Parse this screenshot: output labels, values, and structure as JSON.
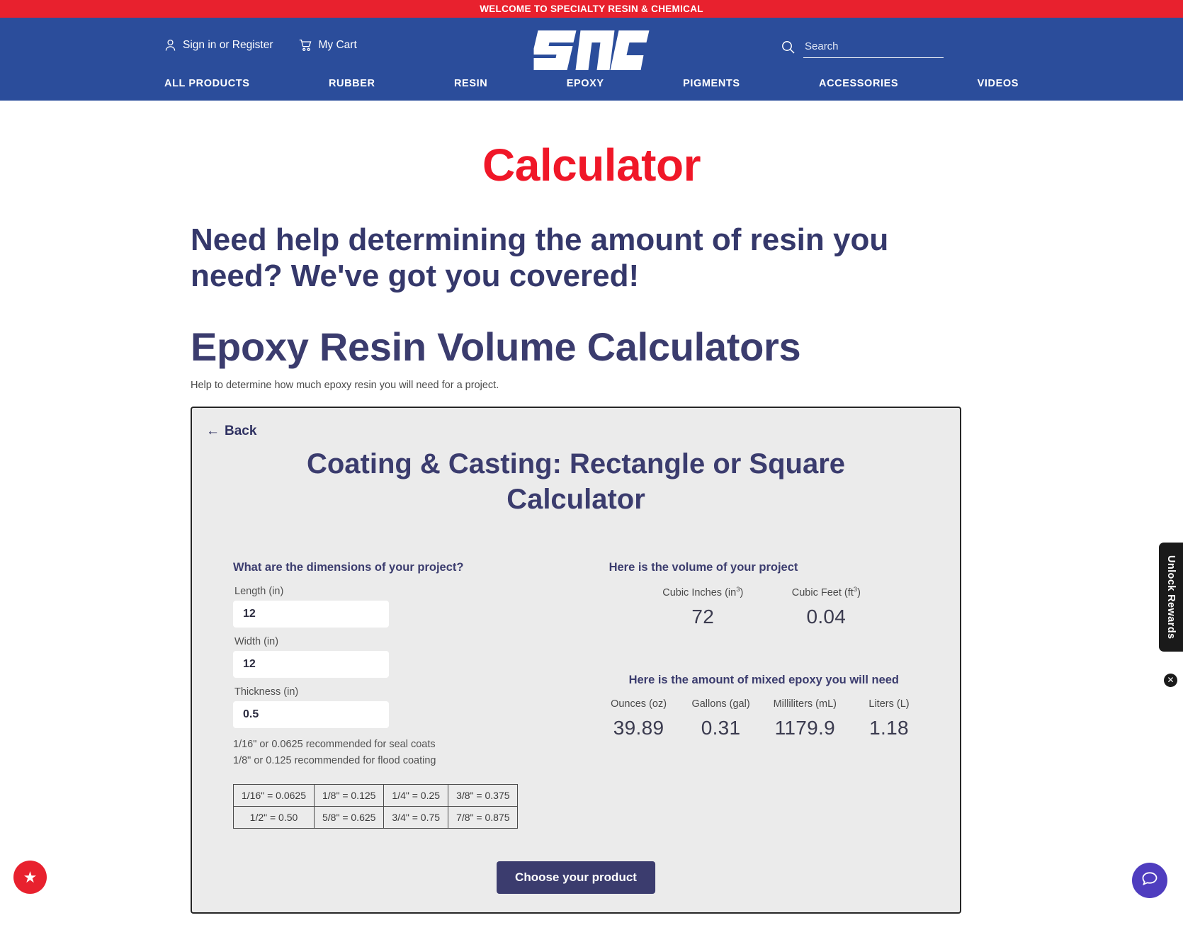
{
  "announcement": {
    "text": "WELCOME TO SPECIALTY RESIN & CHEMICAL"
  },
  "header": {
    "sign_in": "Sign in or Register",
    "cart": "My Cart",
    "logo_text": "SRC",
    "search": {
      "placeholder": "Search",
      "value": ""
    },
    "nav": [
      {
        "label": "ALL PRODUCTS"
      },
      {
        "label": "RUBBER"
      },
      {
        "label": "RESIN"
      },
      {
        "label": "EPOXY"
      },
      {
        "label": "PIGMENTS"
      },
      {
        "label": "ACCESSORIES"
      },
      {
        "label": "VIDEOS"
      }
    ]
  },
  "page": {
    "title": "Calculator",
    "lead": "Need help determining the amount of resin you need? We've got you covered!",
    "section_heading": "Epoxy Resin Volume Calculators",
    "section_sub": "Help to determine how much epoxy resin you will need for a project."
  },
  "calculator": {
    "back_label": "Back",
    "title": "Coating & Casting: Rectangle or Square Calculator",
    "dimensions_heading": "What are the dimensions of your project?",
    "fields": [
      {
        "label": "Length (in)",
        "value": "12",
        "placeholder": ""
      },
      {
        "label": "Width (in)",
        "value": "12",
        "placeholder": ""
      },
      {
        "label": "Thickness (in)",
        "value": "0.5",
        "placeholder": ""
      }
    ],
    "hints": [
      "1/16\" or 0.0625 recommended for seal coats",
      "1/8\" or 0.125 recommended for flood coating"
    ],
    "fraction_table": [
      [
        "1/16\" = 0.0625",
        "1/8\" = 0.125",
        "1/4\" = 0.25",
        "3/8\" = 0.375"
      ],
      [
        "1/2\" = 0.50",
        "5/8\" = 0.625",
        "3/4\" = 0.75",
        "7/8\" = 0.875"
      ]
    ],
    "volume": {
      "heading": "Here is the volume of your project",
      "units": [
        {
          "label_main": "Cubic Inches (in",
          "sup": "3",
          "label_end": ")",
          "value": "72"
        },
        {
          "label_main": "Cubic Feet (ft",
          "sup": "3",
          "label_end": ")",
          "value": "0.04"
        }
      ]
    },
    "mixed": {
      "heading": "Here is the amount of mixed epoxy you will need",
      "units": [
        {
          "label": "Ounces (oz)",
          "value": "39.89"
        },
        {
          "label": "Gallons (gal)",
          "value": "0.31"
        },
        {
          "label": "Milliliters (mL)",
          "value": "1179.9"
        },
        {
          "label": "Liters (L)",
          "value": "1.18"
        }
      ]
    },
    "choose_button": "Choose your product"
  },
  "widgets": {
    "rewards_tab": "Unlock Rewards",
    "rewards_close": "✕",
    "star": "★"
  },
  "colors": {
    "announce_red": "#e8212e",
    "header_blue": "#2b4d9b",
    "title_red": "#f01728",
    "navy": "#3b3c6e",
    "card_bg": "#ebebeb"
  }
}
